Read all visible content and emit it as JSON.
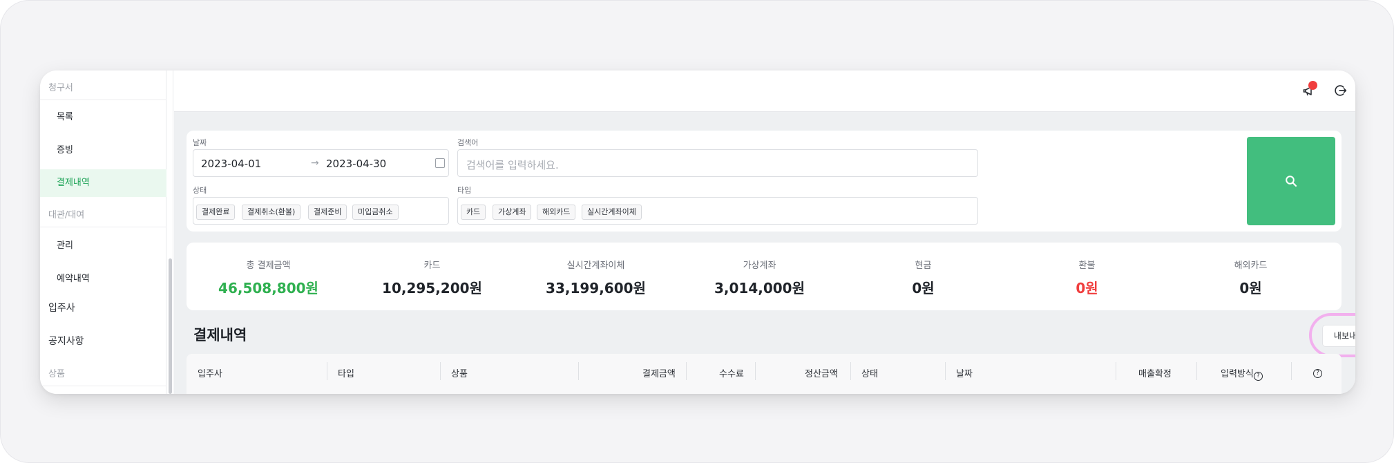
{
  "sidebar": {
    "items": [
      {
        "kind": "section",
        "label": "청구서"
      },
      {
        "kind": "item",
        "label": "목록"
      },
      {
        "kind": "item",
        "label": "증빙"
      },
      {
        "kind": "item",
        "label": "결제내역",
        "active": true
      },
      {
        "kind": "section",
        "label": "대관/대여"
      },
      {
        "kind": "item",
        "label": "관리"
      },
      {
        "kind": "item",
        "label": "예약내역"
      },
      {
        "kind": "top",
        "label": "입주사"
      },
      {
        "kind": "top",
        "label": "공지사항"
      },
      {
        "kind": "section",
        "label": "상품"
      }
    ]
  },
  "header": {
    "icons": [
      "notification-icon",
      "logout-icon"
    ],
    "notification_dot_color": "#f03e3e"
  },
  "filters": {
    "date_label": "날짜",
    "date_start": "2023-04-01",
    "date_arrow": "→",
    "date_end": "2023-04-30",
    "search_label": "검색어",
    "search_placeholder": "검색어를 입력하세요.",
    "status_label": "상태",
    "status_chips": [
      "결제완료",
      "결제취소(환불)",
      "결제준비",
      "미입금취소"
    ],
    "type_label": "타입",
    "type_chips": [
      "카드",
      "가상계좌",
      "해외카드",
      "실시간계좌이체"
    ],
    "search_button_color": "#42be7e"
  },
  "summary": [
    {
      "label": "총 결제금액",
      "value": "46,508,800원",
      "tone": "green"
    },
    {
      "label": "카드",
      "value": "10,295,200원",
      "tone": "normal"
    },
    {
      "label": "실시간계좌이체",
      "value": "33,199,600원",
      "tone": "normal"
    },
    {
      "label": "가상계좌",
      "value": "3,014,000원",
      "tone": "normal"
    },
    {
      "label": "현금",
      "value": "0원",
      "tone": "normal"
    },
    {
      "label": "환불",
      "value": "0원",
      "tone": "red"
    },
    {
      "label": "해외카드",
      "value": "0원",
      "tone": "normal"
    }
  ],
  "list": {
    "title": "결제내역",
    "export_label": "내보내기",
    "columns": [
      "입주사",
      "타입",
      "상품",
      "결제금액",
      "수수료",
      "정산금액",
      "상태",
      "날짜",
      "매출확정",
      "입력방식"
    ]
  }
}
